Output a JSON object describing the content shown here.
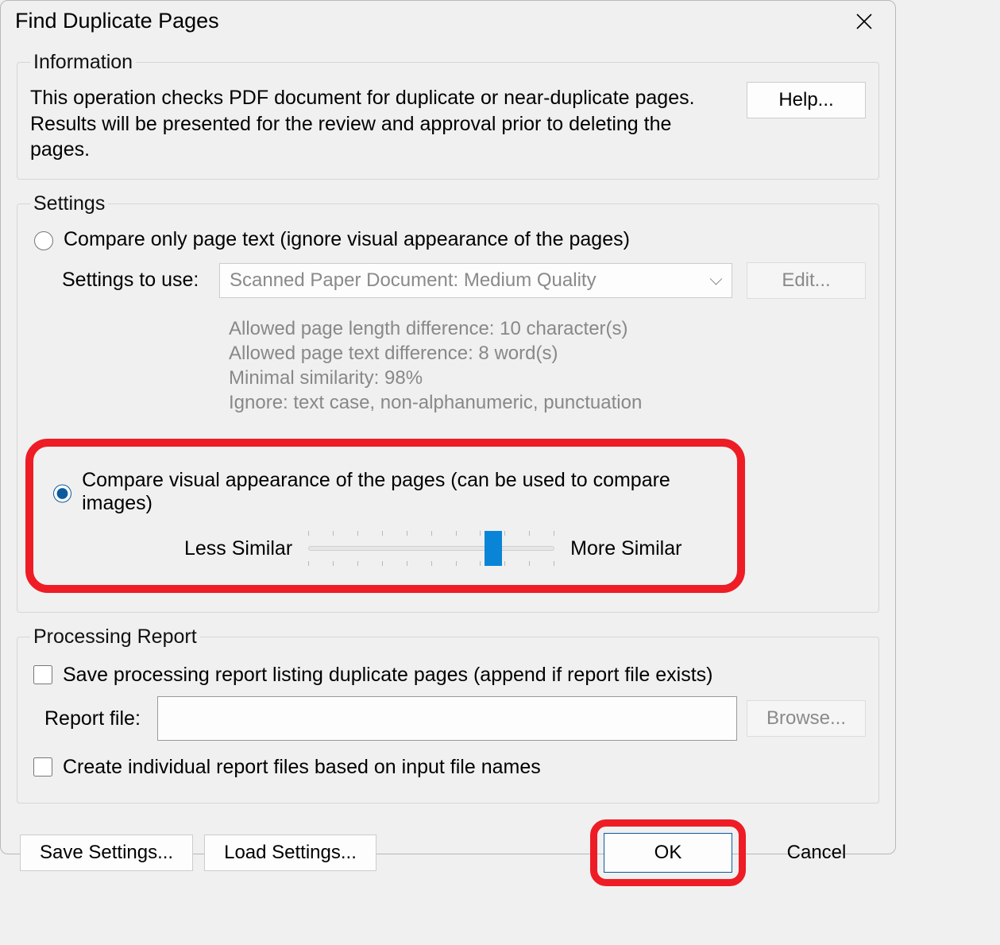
{
  "title": "Find Duplicate Pages",
  "information": {
    "legend": "Information",
    "text": "This operation checks PDF document for duplicate or near-duplicate pages. Results will be presented for the review and approval prior to deleting the pages.",
    "help_label": "Help..."
  },
  "settings": {
    "legend": "Settings",
    "option_text_only": "Compare only page text (ignore visual appearance of the pages)",
    "settings_to_use_label": "Settings to use:",
    "settings_value": "Scanned Paper Document: Medium Quality",
    "edit_label": "Edit...",
    "detail1": "Allowed page length difference: 10 character(s)",
    "detail2": "Allowed page text difference: 8 word(s)",
    "detail3": "Minimal similarity: 98%",
    "detail4": "Ignore: text case, non-alphanumeric, punctuation",
    "option_visual": "Compare visual appearance of the pages (can be used to compare images)",
    "less_similar": "Less Similar",
    "more_similar": "More Similar"
  },
  "report": {
    "legend": "Processing Report",
    "save_report": "Save processing report listing duplicate pages (append if report file exists)",
    "file_label": "Report file:",
    "browse_label": "Browse...",
    "individual": "Create individual report files based on input file names"
  },
  "buttons": {
    "save_settings": "Save Settings...",
    "load_settings": "Load Settings...",
    "ok": "OK",
    "cancel": "Cancel"
  }
}
